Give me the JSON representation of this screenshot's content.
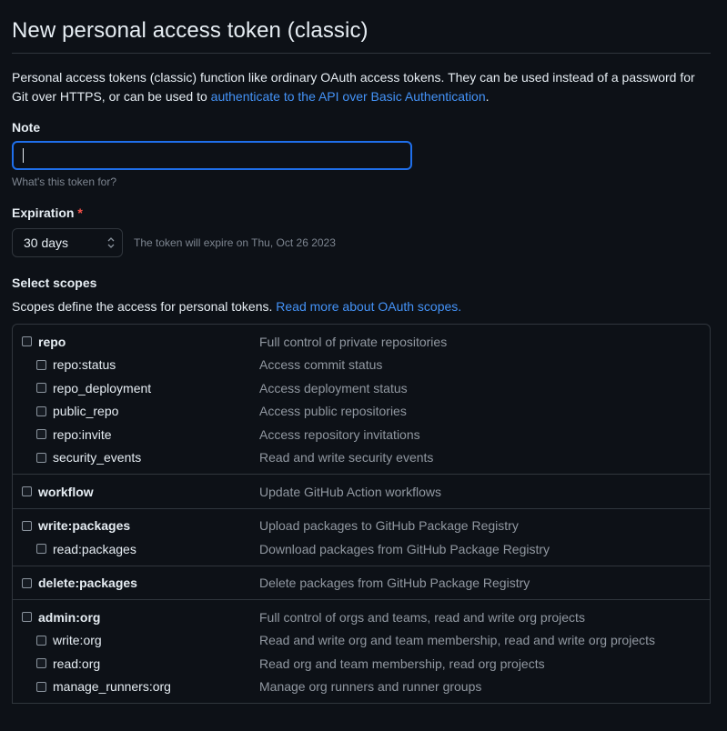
{
  "title": "New personal access token (classic)",
  "intro": {
    "text": "Personal access tokens (classic) function like ordinary OAuth access tokens. They can be used instead of a password for Git over HTTPS, or can be used to ",
    "link": "authenticate to the API over Basic Authentication",
    "suffix": "."
  },
  "note": {
    "label": "Note",
    "value": "",
    "placeholder": "",
    "hint": "What's this token for?"
  },
  "expiration": {
    "label": "Expiration",
    "required_mark": "*",
    "selected": "30 days",
    "note": "The token will expire on Thu, Oct 26 2023"
  },
  "scopes": {
    "label": "Select scopes",
    "desc": "Scopes define the access for personal tokens. ",
    "link": "Read more about OAuth scopes.",
    "groups": [
      {
        "parent": {
          "name": "repo",
          "desc": "Full control of private repositories"
        },
        "children": [
          {
            "name": "repo:status",
            "desc": "Access commit status"
          },
          {
            "name": "repo_deployment",
            "desc": "Access deployment status"
          },
          {
            "name": "public_repo",
            "desc": "Access public repositories"
          },
          {
            "name": "repo:invite",
            "desc": "Access repository invitations"
          },
          {
            "name": "security_events",
            "desc": "Read and write security events"
          }
        ]
      },
      {
        "parent": {
          "name": "workflow",
          "desc": "Update GitHub Action workflows"
        },
        "children": []
      },
      {
        "parent": {
          "name": "write:packages",
          "desc": "Upload packages to GitHub Package Registry"
        },
        "children": [
          {
            "name": "read:packages",
            "desc": "Download packages from GitHub Package Registry"
          }
        ]
      },
      {
        "parent": {
          "name": "delete:packages",
          "desc": "Delete packages from GitHub Package Registry"
        },
        "children": []
      },
      {
        "parent": {
          "name": "admin:org",
          "desc": "Full control of orgs and teams, read and write org projects"
        },
        "children": [
          {
            "name": "write:org",
            "desc": "Read and write org and team membership, read and write org projects"
          },
          {
            "name": "read:org",
            "desc": "Read org and team membership, read org projects"
          },
          {
            "name": "manage_runners:org",
            "desc": "Manage org runners and runner groups"
          }
        ]
      }
    ]
  },
  "colors": {
    "background": "#0d1117",
    "link": "#4493f8",
    "focus_border": "#1f6feb",
    "required": "#f85149"
  }
}
